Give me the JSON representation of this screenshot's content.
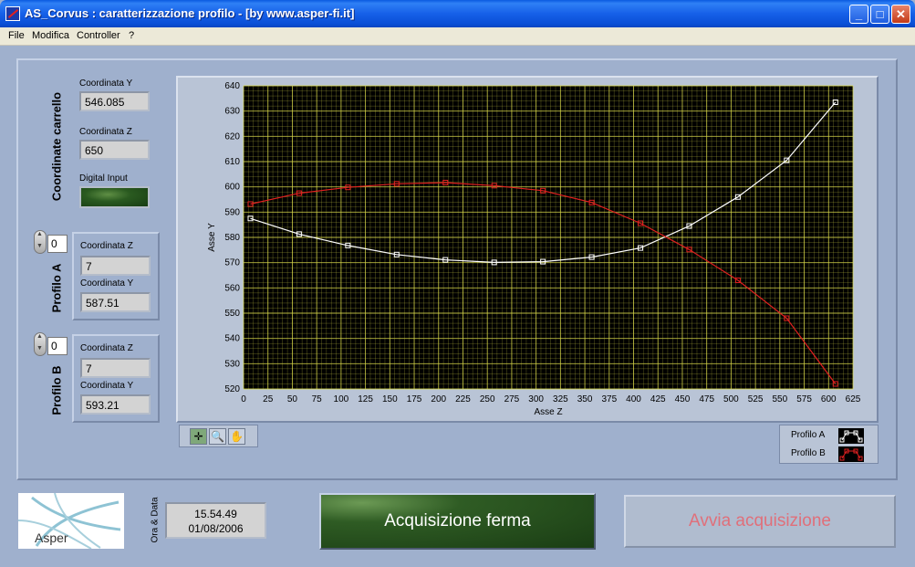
{
  "window": {
    "title": "AS_Corvus : caratterizzazione profilo - [by www.asper-fi.it]",
    "controls": {
      "minimize": "_",
      "maximize": "□",
      "close": "✕"
    }
  },
  "menu": [
    "File",
    "Modifica",
    "Controller",
    "?"
  ],
  "carriage": {
    "section_label": "Coordinate carrello",
    "coord_y_label": "Coordinata Y",
    "coord_y_value": "546.085",
    "coord_z_label": "Coordinata Z",
    "coord_z_value": "650",
    "digital_input_label": "Digital Input"
  },
  "profile_a": {
    "section_label": "Profilo A",
    "index_value": "0",
    "coord_z_label": "Coordinata Z",
    "coord_z_value": "7",
    "coord_y_label": "Coordinata Y",
    "coord_y_value": "587.51"
  },
  "profile_b": {
    "section_label": "Profilo B",
    "index_value": "0",
    "coord_z_label": "Coordinata Z",
    "coord_z_value": "7",
    "coord_y_label": "Coordinata Y",
    "coord_y_value": "593.21"
  },
  "graph_tools": {
    "cursor": "✛",
    "zoom": "🔍",
    "pan": "✋"
  },
  "chart_data": {
    "type": "line",
    "xlabel": "Asse Z",
    "ylabel": "Asse Y",
    "xlim": [
      0,
      625
    ],
    "ylim": [
      520,
      640
    ],
    "xticks": [
      0,
      25,
      50,
      75,
      100,
      125,
      150,
      175,
      200,
      225,
      250,
      275,
      300,
      325,
      350,
      375,
      400,
      425,
      450,
      475,
      500,
      525,
      550,
      575,
      600,
      625
    ],
    "yticks": [
      520,
      530,
      540,
      550,
      560,
      570,
      580,
      590,
      600,
      610,
      620,
      630,
      640
    ],
    "grid": true,
    "legend_position": "bottom-right",
    "background": "#000000",
    "grid_color": "#d8d84a",
    "series": [
      {
        "name": "Profilo A",
        "color": "#ffffff",
        "points": [
          [
            7,
            587.5
          ],
          [
            57,
            581.3
          ],
          [
            107,
            576.8
          ],
          [
            157,
            573.2
          ],
          [
            207,
            571.1
          ],
          [
            257,
            570.1
          ],
          [
            307,
            570.4
          ],
          [
            357,
            572.2
          ],
          [
            407,
            575.8
          ],
          [
            457,
            584.5
          ],
          [
            507,
            596.0
          ],
          [
            557,
            610.5
          ],
          [
            607,
            633.5
          ]
        ]
      },
      {
        "name": "Profilo B",
        "color": "#e02020",
        "points": [
          [
            7,
            593.2
          ],
          [
            57,
            597.5
          ],
          [
            107,
            599.8
          ],
          [
            157,
            601.2
          ],
          [
            207,
            601.7
          ],
          [
            257,
            600.5
          ],
          [
            307,
            598.5
          ],
          [
            357,
            593.8
          ],
          [
            407,
            585.6
          ],
          [
            457,
            575.2
          ],
          [
            507,
            563.0
          ],
          [
            557,
            548.0
          ],
          [
            607,
            522.0
          ]
        ]
      }
    ]
  },
  "logo": {
    "text": "Asper"
  },
  "clock": {
    "label": "Ora & Data",
    "time": "15.54.49",
    "date": "01/08/2006"
  },
  "buttons": {
    "stop": "Acquisizione ferma",
    "start": "Avvia acquisizione"
  }
}
